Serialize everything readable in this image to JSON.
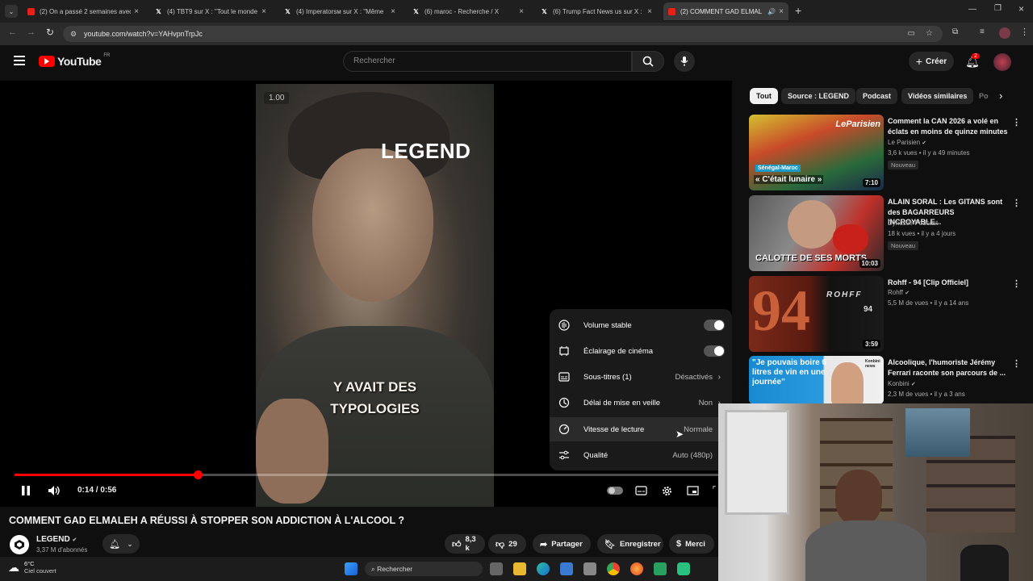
{
  "browser": {
    "tabs": [
      {
        "title": "(2) On a passé 2 semaines avec",
        "icon": "youtube-icon",
        "active": false
      },
      {
        "title": "(4) TBT9 sur X : \"Tout le monde",
        "icon": "x-icon",
        "active": false
      },
      {
        "title": "(4) Imperatorsм sur X : \"Même",
        "icon": "x-icon",
        "active": false
      },
      {
        "title": "(6) maroc - Recherche / X",
        "icon": "x-icon",
        "active": false
      },
      {
        "title": "(6) Trump Fact News us sur X : \"",
        "icon": "x-icon",
        "active": false
      },
      {
        "title": "(2) COMMENT GAD ELMAL",
        "icon": "youtube-icon",
        "active": true
      }
    ],
    "new_tab": "+",
    "url": "youtube.com/watch?v=YAHvpnTrpJc"
  },
  "header": {
    "logo": "YouTube",
    "region": "FR",
    "search_placeholder": "Rechercher",
    "create_label": "Créer",
    "notif_count": "2"
  },
  "player": {
    "speed_overlay": "1.00",
    "brand_overlay": "LEGEND",
    "caption_line1": "Y AVAIT DES",
    "caption_line2": "TYPOLOGIES",
    "time": "0:14 / 0:56",
    "progress": 0.26
  },
  "settings_menu": {
    "items": [
      {
        "label": "Volume stable",
        "value": "",
        "type": "toggle"
      },
      {
        "label": "Éclairage de cinéma",
        "value": "",
        "type": "toggle"
      },
      {
        "label": "Sous-titres (1)",
        "value": "Désactivés",
        "type": "submenu"
      },
      {
        "label": "Délai de mise en veille",
        "value": "Non",
        "type": "submenu"
      },
      {
        "label": "Vitesse de lecture",
        "value": "Normale",
        "type": "submenu"
      },
      {
        "label": "Qualité",
        "value": "Auto (480p)",
        "type": "submenu"
      }
    ]
  },
  "video": {
    "title": "COMMENT GAD ELMALEH A RÉUSSI À STOPPER SON ADDICTION À L'ALCOOL ?",
    "channel": "LEGEND",
    "subscribers": "3,37 M d'abonnés",
    "likes": "8,3 k",
    "dislikes": "29",
    "share_label": "Partager",
    "save_label": "Enregistrer",
    "thanks_label": "Merci"
  },
  "chips": [
    "Tout",
    "Source : LEGEND",
    "Podcast",
    "Vidéos similaires",
    "Po"
  ],
  "recommendations": [
    {
      "title": "Comment la CAN 2026 a volé en éclats en moins de quinze minutes",
      "channel": "Le Parisien",
      "meta": "3,6 k vues • il y a 49 minutes",
      "badge": "Nouveau",
      "duration": "7:10",
      "thumb_text": "« C'était lunaire »",
      "thumb_tag": "Sénégal-Maroc",
      "thumb_brand": "LeParisien"
    },
    {
      "title": "ALAIN SORAL : Les GITANS sont des BAGARREURS INCROYABLE...",
      "channel": "Dynastie Podcast",
      "meta": "18 k vues • il y a 4 jours",
      "badge": "Nouveau",
      "duration": "10:03",
      "thumb_text": "CALOTTE DE SES MORTS"
    },
    {
      "title": "Rohff - 94 [Clip Officiel]",
      "channel": "Rohff",
      "meta": "5,5 M de vues • il y a 14 ans",
      "badge": "",
      "duration": "3:59",
      "thumb_text": "94",
      "thumb_brand": "ROHFF"
    },
    {
      "title": "Alcoolique, l'humoriste Jérémy Ferrari raconte son parcours de ...",
      "channel": "Konbini",
      "meta": "2,3 M de vues • il y a 3 ans",
      "badge": "",
      "duration": "",
      "thumb_text": "\"Je pouvais boire 6 litres de vin en une journée\"",
      "thumb_brand": "Konbini news"
    }
  ],
  "taskbar": {
    "temperature": "6°C",
    "weather": "Ciel couvert",
    "search_label": "Rechercher"
  },
  "colors": {
    "accent": "#ff0000",
    "background": "#0f0f0f",
    "surface": "#272727"
  }
}
